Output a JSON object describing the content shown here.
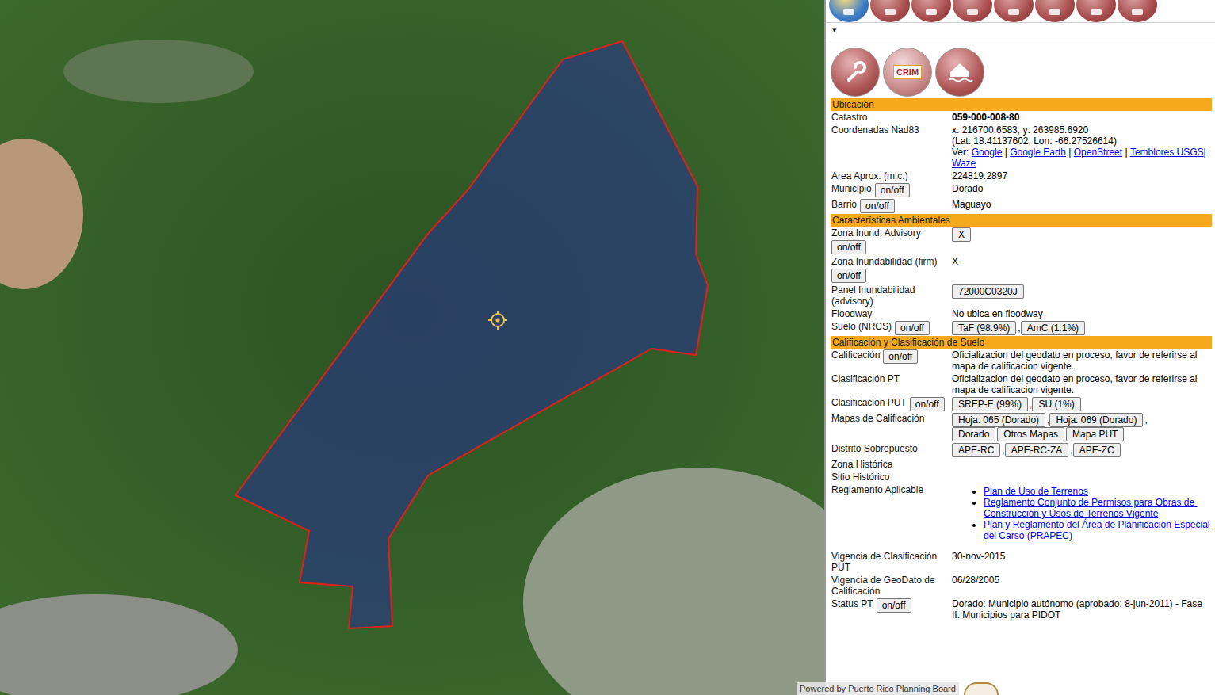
{
  "dropdown": "▾",
  "logos": {
    "crim": "CRIM"
  },
  "sections": [
    {
      "title": "Ubicación",
      "rows": [
        {
          "label": "Catastro",
          "toggle": "",
          "lines": [
            [
              {
                "t": "059-000-008-80",
                "k": "bold"
              }
            ]
          ],
          "bullets": []
        },
        {
          "label": "Coordenadas Nad83",
          "toggle": "",
          "lines": [
            [
              {
                "t": "x: 216700.6583, y: 263985.6920",
                "k": "plain"
              }
            ],
            [
              {
                "t": "(Lat: 18.41137602, Lon: -66.27526614)",
                "k": "plain"
              }
            ],
            [
              {
                "t": "Ver: ",
                "k": "plain"
              },
              {
                "t": "Google",
                "k": "link"
              },
              {
                "t": " | ",
                "k": "plain"
              },
              {
                "t": "Google Earth",
                "k": "link"
              },
              {
                "t": " | ",
                "k": "plain"
              },
              {
                "t": "OpenStreet",
                "k": "link"
              },
              {
                "t": " | ",
                "k": "plain"
              },
              {
                "t": "Temblores USGS",
                "k": "link"
              },
              {
                "t": "|",
                "k": "plain"
              }
            ],
            [
              {
                "t": "Waze",
                "k": "link"
              }
            ]
          ],
          "bullets": []
        },
        {
          "label": "Area Aprox. (m.c.)",
          "toggle": "",
          "lines": [
            [
              {
                "t": "224819.2897",
                "k": "plain"
              }
            ]
          ],
          "bullets": []
        },
        {
          "label": "Municipio",
          "toggle": "on/off",
          "lines": [
            [
              {
                "t": "Dorado",
                "k": "plain"
              }
            ]
          ],
          "bullets": []
        },
        {
          "label": "Barrio",
          "toggle": "on/off",
          "lines": [
            [
              {
                "t": "Maguayo",
                "k": "plain"
              }
            ]
          ],
          "bullets": []
        }
      ]
    },
    {
      "title": "Características Ambientales",
      "rows": [
        {
          "label": "Zona Inund. Advisory",
          "toggle": "on/off",
          "lines": [
            [
              {
                "t": "X",
                "k": "button"
              }
            ]
          ],
          "bullets": []
        },
        {
          "label": "Zona Inundabilidad (firm)",
          "toggle": "on/off",
          "lines": [
            [
              {
                "t": "X",
                "k": "plain"
              }
            ]
          ],
          "bullets": []
        },
        {
          "label": "Panel Inundabilidad (advisory)",
          "toggle": "",
          "lines": [
            [
              {
                "t": "72000C0320J",
                "k": "button"
              }
            ]
          ],
          "bullets": []
        },
        {
          "label": "Floodway",
          "toggle": "",
          "lines": [
            [
              {
                "t": "No ubica en floodway",
                "k": "plain"
              }
            ]
          ],
          "bullets": []
        },
        {
          "label": "Suelo (NRCS)",
          "toggle": "on/off",
          "lines": [
            [
              {
                "t": "TaF (98.9%)",
                "k": "button"
              },
              {
                "t": ",",
                "k": "plain"
              },
              {
                "t": "AmC (1.1%)",
                "k": "button"
              }
            ]
          ],
          "bullets": []
        }
      ]
    },
    {
      "title": "Calificación y Clasificación de Suelo",
      "rows": [
        {
          "label": "Calificación",
          "toggle": "on/off",
          "lines": [
            [
              {
                "t": "Oficializacion del geodato en proceso, favor de referirse al mapa de calificacion vigente.",
                "k": "plain"
              }
            ]
          ],
          "bullets": []
        },
        {
          "label": "Clasificación PT",
          "toggle": "",
          "lines": [
            [
              {
                "t": "Oficializacion del geodato en proceso, favor de referirse al mapa de calificacion vigente.",
                "k": "plain"
              }
            ]
          ],
          "bullets": []
        },
        {
          "label": "Clasificación PUT",
          "toggle": "on/off",
          "lines": [
            [
              {
                "t": "SREP-E (99%)",
                "k": "button"
              },
              {
                "t": ",",
                "k": "plain"
              },
              {
                "t": "SU (1%)",
                "k": "button"
              }
            ]
          ],
          "bullets": []
        },
        {
          "label": "Mapas de Calificación",
          "toggle": "",
          "lines": [
            [
              {
                "t": "Hoja: 065 (Dorado)",
                "k": "button"
              },
              {
                "t": ",",
                "k": "plain"
              },
              {
                "t": "Hoja: 069 (Dorado)",
                "k": "button"
              },
              {
                "t": ",",
                "k": "plain"
              }
            ],
            [
              {
                "t": "Dorado",
                "k": "button"
              },
              {
                "t": "Otros Mapas",
                "k": "button"
              },
              {
                "t": "Mapa PUT",
                "k": "button"
              }
            ]
          ],
          "bullets": []
        },
        {
          "label": "Distrito Sobrepuesto",
          "toggle": "",
          "lines": [
            [
              {
                "t": "APE-RC",
                "k": "button"
              },
              {
                "t": ",",
                "k": "plain"
              },
              {
                "t": "APE-RC-ZA",
                "k": "button"
              },
              {
                "t": ",",
                "k": "plain"
              },
              {
                "t": "APE-ZC",
                "k": "button"
              }
            ]
          ],
          "bullets": []
        },
        {
          "label": "Zona Histórica",
          "toggle": "",
          "lines": [],
          "bullets": []
        },
        {
          "label": "Sitio Histórico",
          "toggle": "",
          "lines": [],
          "bullets": []
        },
        {
          "label": "Reglamento Aplicable",
          "toggle": "",
          "lines": [],
          "bullets": [
            "Plan de Uso de Terrenos",
            "Reglamento Conjunto de Permisos para Obras de Construcción y Usos de Terrenos Vigente",
            "Plan y Reglamento del Área de Planificación Especial del Carso (PRAPEC)"
          ]
        },
        {
          "label": "Vigencia de Clasificación PUT",
          "toggle": "",
          "lines": [
            [
              {
                "t": "30-nov-2015",
                "k": "plain"
              }
            ]
          ],
          "bullets": []
        },
        {
          "label": "Vigencia de GeoDato de Calificación",
          "toggle": "",
          "lines": [
            [
              {
                "t": "06/28/2005",
                "k": "plain"
              }
            ]
          ],
          "bullets": []
        },
        {
          "label": "Status PT",
          "toggle": "on/off",
          "lines": [
            [
              {
                "t": "Dorado: Municipio autónomo (aprobado: 8-jun-2011) - Fase II: Municipios para PIDOT",
                "k": "plain"
              }
            ]
          ],
          "bullets": []
        }
      ]
    }
  ],
  "footer": {
    "powered": "Powered by Puerto Rico Planning Board"
  }
}
